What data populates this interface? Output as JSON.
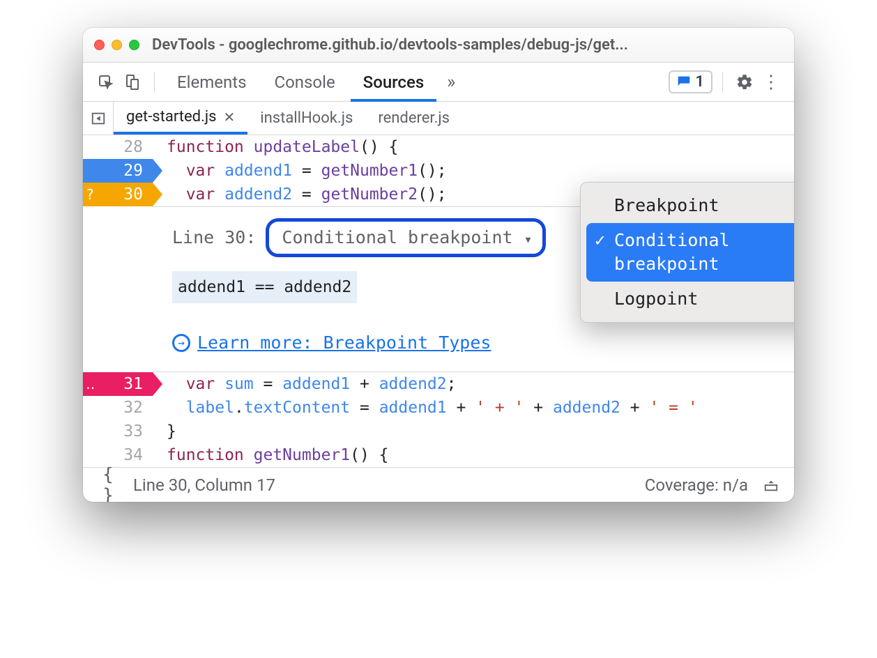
{
  "window": {
    "title": "DevTools - googlechrome.github.io/devtools-samples/debug-js/get..."
  },
  "tabs": {
    "items": [
      "Elements",
      "Console",
      "Sources"
    ],
    "active": 2,
    "issues_count": "1"
  },
  "file_tabs": {
    "items": [
      "get-started.js",
      "installHook.js",
      "renderer.js"
    ],
    "active": 0
  },
  "code": {
    "l28": {
      "num": "28",
      "t1": "function",
      "t2": "updateLabel",
      "t3": "() {"
    },
    "l29": {
      "num": "29",
      "t1": "var",
      "t2": "addend1",
      "t3": " = ",
      "t4": "getNumber1",
      "t5": "();"
    },
    "l30": {
      "num": "30",
      "mark": "?",
      "t1": "var",
      "t2": "addend2",
      "t3": " = ",
      "t4": "getNumber2",
      "t5": "();"
    },
    "l31": {
      "num": "31",
      "mark": "‥",
      "t1": "var",
      "t2": "sum",
      "t3": " = ",
      "t4": "addend1",
      "t5": " + ",
      "t6": "addend2",
      "t7": ";"
    },
    "l32": {
      "num": "32",
      "t1": "label",
      "t2": ".",
      "t3": "textContent",
      "t4": " = ",
      "t5": "addend1",
      "t6": " + ",
      "s1": "' + '",
      "t7": " + ",
      "t8": "addend2",
      "t9": " + ",
      "s2": "' = '"
    },
    "l33": {
      "num": "33",
      "t1": "}"
    },
    "l34": {
      "num": "34",
      "t1": "function",
      "t2": "getNumber1",
      "t3": "() {"
    }
  },
  "bp_panel": {
    "line_label": "Line 30:",
    "select_label": "Conditional breakpoint",
    "condition": "addend1 == addend2",
    "learn": "Learn more: Breakpoint Types"
  },
  "dropdown": {
    "items": [
      "Breakpoint",
      "Conditional breakpoint",
      "Logpoint"
    ],
    "selected": 1
  },
  "status": {
    "pos": "Line 30, Column 17",
    "coverage": "Coverage: n/a"
  }
}
